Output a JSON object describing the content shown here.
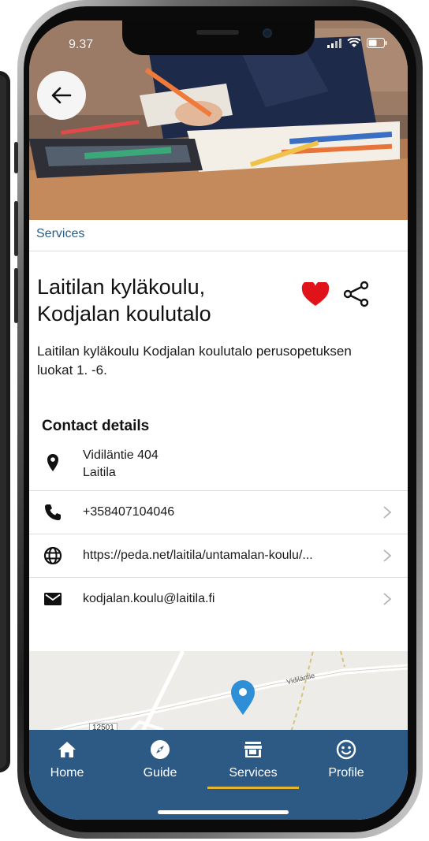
{
  "status_bar": {
    "time": "9.37"
  },
  "breadcrumb": "Services",
  "title": "Laitilan kyläkoulu, Kodjalan koulutalo",
  "description": "Laitilan kyläkoulu Kodjalan koulutalo perusopetuksen luokat 1. -6.",
  "favorite": true,
  "contact": {
    "heading": "Contact details",
    "address_line1": "Vidiläntie 404",
    "address_line2": "Laitila",
    "phone": "+358407104046",
    "website": "https://peda.net/laitila/untamalan-koulu/...",
    "email": "kodjalan.koulu@laitila.fi"
  },
  "map": {
    "road_name": "Vidiläntie",
    "road_number": "12501"
  },
  "nav": {
    "items": [
      {
        "label": "Home",
        "icon": "home-icon"
      },
      {
        "label": "Guide",
        "icon": "compass-icon"
      },
      {
        "label": "Services",
        "icon": "store-icon"
      },
      {
        "label": "Profile",
        "icon": "smiley-icon"
      }
    ],
    "active": "Services"
  },
  "colors": {
    "nav_background": "#2d5a85",
    "active_underline": "#e6b52e",
    "favorite_heart": "#e0121a",
    "link_blue": "#2c5c86",
    "map_pin": "#2f8fd6"
  }
}
